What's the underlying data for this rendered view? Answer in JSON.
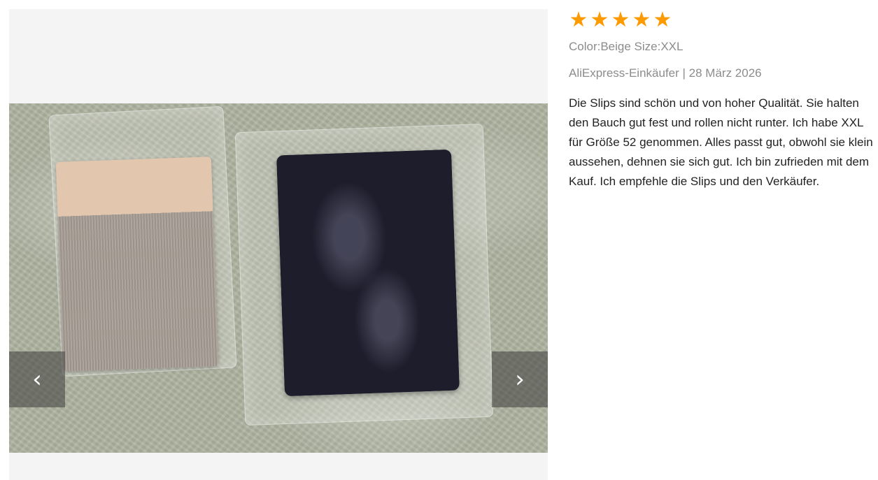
{
  "gallery": {
    "prev_icon": "chevron-left-icon",
    "prev_glyph": "‹",
    "next_icon": "chevron-right-icon",
    "next_glyph": "›"
  },
  "review": {
    "rating": 5,
    "rating_max": 5,
    "star_color": "#fd9a00",
    "sku": "Color:Beige Size:XXL",
    "author": "AliExpress-Einkäufer",
    "separator": "|",
    "date": "28 März 2026",
    "text": "Die Slips sind schön und von hoher Qualität. Sie halten den Bauch gut fest und rollen nicht runter. Ich habe XXL für Größe 52 genommen. Alles passt gut, obwohl sie klein aussehen, dehnen sie sich gut. Ich bin zufrieden mit dem Kauf. Ich empfehle die Slips und den Verkäufer."
  }
}
